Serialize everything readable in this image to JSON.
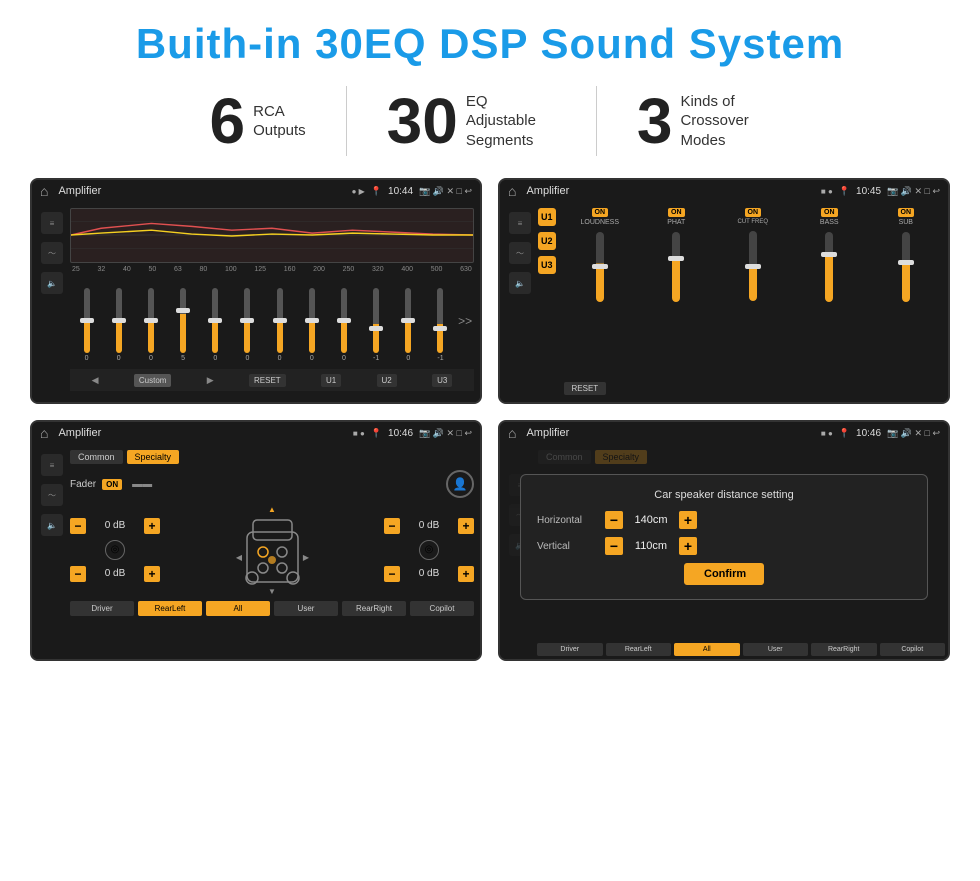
{
  "title": "Buith-in 30EQ DSP Sound System",
  "stats": [
    {
      "number": "6",
      "label": "RCA\nOutputs"
    },
    {
      "number": "30",
      "label": "EQ Adjustable\nSegments"
    },
    {
      "number": "3",
      "label": "Kinds of\nCrossover Modes"
    }
  ],
  "screens": {
    "eq": {
      "title": "Amplifier",
      "time": "10:44",
      "freq_labels": [
        "25",
        "32",
        "40",
        "50",
        "63",
        "80",
        "100",
        "125",
        "160",
        "200",
        "250",
        "320",
        "400",
        "500",
        "630"
      ],
      "slider_vals": [
        "0",
        "0",
        "0",
        "5",
        "0",
        "0",
        "0",
        "0",
        "0",
        "-1",
        "0",
        "-1"
      ],
      "nav_items": [
        "Custom",
        "RESET",
        "U1",
        "U2",
        "U3"
      ]
    },
    "crossover": {
      "title": "Amplifier",
      "time": "10:45",
      "u_buttons": [
        "U1",
        "U2",
        "U3"
      ],
      "channels": [
        "LOUDNESS",
        "PHAT",
        "CUT FREQ",
        "BASS",
        "SUB"
      ],
      "reset_label": "RESET"
    },
    "fader": {
      "title": "Amplifier",
      "time": "10:46",
      "tabs": [
        "Common",
        "Specialty"
      ],
      "fader_label": "Fader",
      "on_label": "ON",
      "db_values": [
        "0 dB",
        "0 dB",
        "0 dB",
        "0 dB"
      ],
      "bottom_buttons": [
        "Driver",
        "RearLeft",
        "All",
        "User",
        "RearRight",
        "Copilot"
      ]
    },
    "distance": {
      "title": "Amplifier",
      "time": "10:46",
      "dialog_title": "Car speaker distance setting",
      "horizontal_label": "Horizontal",
      "horizontal_val": "140cm",
      "vertical_label": "Vertical",
      "vertical_val": "110cm",
      "confirm_label": "Confirm",
      "bottom_buttons": [
        "Driver",
        "RearLeft",
        "All",
        "User",
        "RearRight",
        "Copilot"
      ]
    }
  }
}
